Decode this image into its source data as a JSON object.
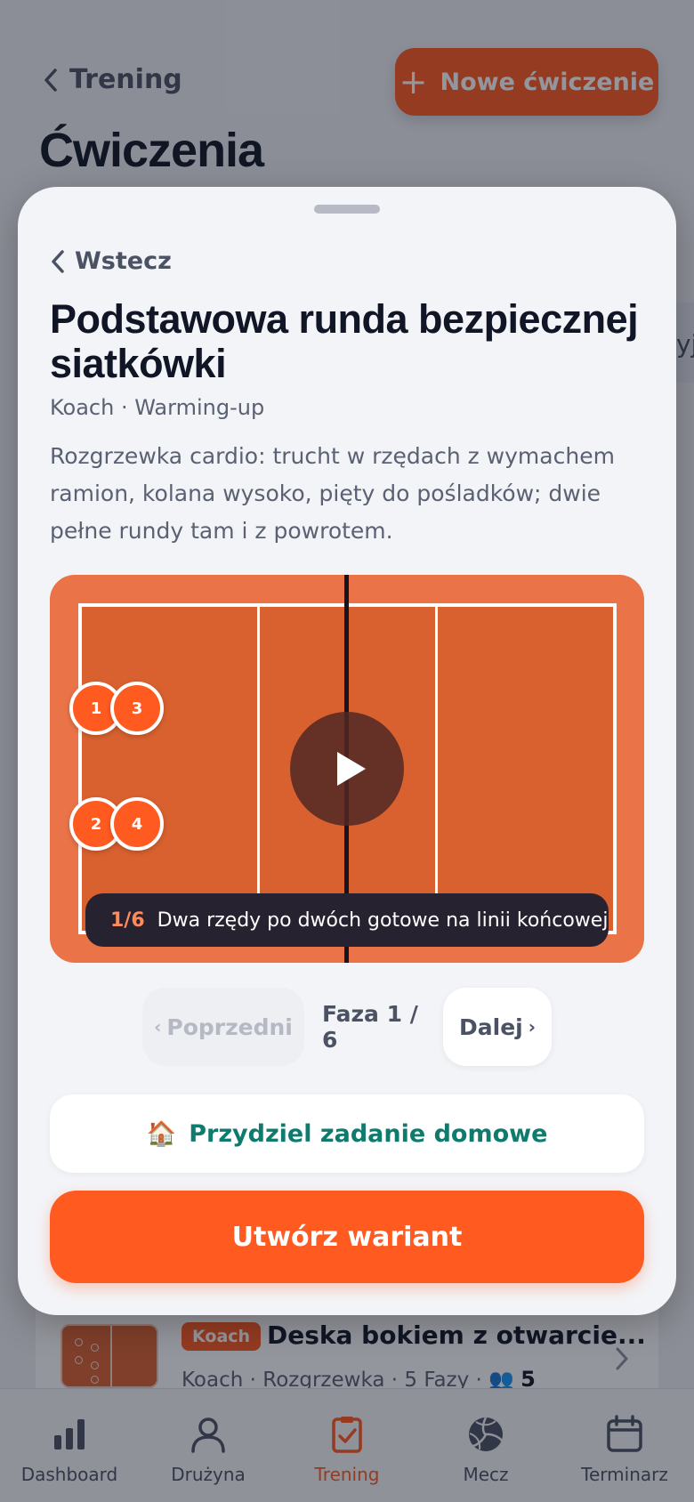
{
  "background": {
    "back_label": "Trening",
    "new_button_label": "Nowe ćwiczenie",
    "page_title": "Ćwiczenia",
    "edge_chip_text": "yj",
    "card": {
      "badge": "Koach",
      "title": "Deska bokiem z otwarcie...",
      "subtitle": "Koach · Rozgrzewka · 5 Fazy · 👥",
      "players": "5"
    }
  },
  "sheet": {
    "back_label": "Wstecz",
    "title": "Podstawowa runda bezpiecznej siatkówki",
    "meta": "Koach · Warming-up",
    "description": "Rozgrzewka cardio: trucht w rzędach z wymachem ramion, kolana wysoko, pięty do pośladków; dwie pełne rundy tam i z powrotem.",
    "court": {
      "players": [
        "1",
        "3",
        "2",
        "4"
      ],
      "phase_counter": "1/6",
      "phase_caption": "Dwa rzędy po dwóch gotowe na linii końcowej"
    },
    "phase_nav": {
      "prev_label": "Poprzedni",
      "phase_label": "Faza 1 / 6",
      "next_label": "Dalej"
    },
    "homework_label": "Przydziel zadanie domowe",
    "homework_icon": "🏠",
    "variant_label": "Utwórz wariant"
  },
  "tabbar": {
    "tabs": [
      {
        "label": "Dashboard"
      },
      {
        "label": "Drużyna"
      },
      {
        "label": "Trening"
      },
      {
        "label": "Mecz"
      },
      {
        "label": "Terminarz"
      }
    ]
  },
  "colors": {
    "accent": "#ff5a1f",
    "court_outer": "#ea7448",
    "court_inner": "#d9612f",
    "homework_text": "#0f7a6e",
    "title": "#111626"
  }
}
